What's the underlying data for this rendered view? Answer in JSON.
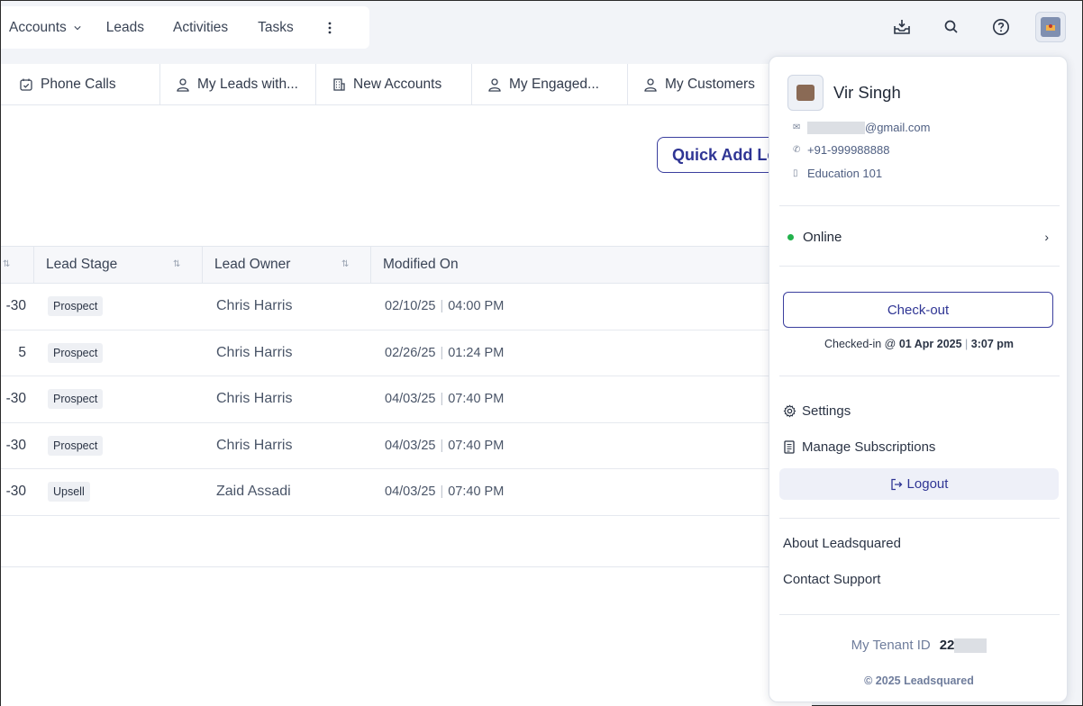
{
  "topnav": {
    "accounts": "Accounts",
    "leads": "Leads",
    "activities": "Activities",
    "tasks": "Tasks"
  },
  "tabs": [
    {
      "label": "Phone Calls",
      "icon": "calendar-check-icon"
    },
    {
      "label": "My Leads with...",
      "icon": "user-icon"
    },
    {
      "label": "New Accounts",
      "icon": "building-icon"
    },
    {
      "label": "My Engaged...",
      "icon": "user-icon"
    },
    {
      "label": "My Customers",
      "icon": "user-icon"
    }
  ],
  "main": {
    "quick_add_label": "Quick Add Le"
  },
  "table": {
    "headers": [
      "Lead Stage",
      "Lead Owner",
      "Modified On"
    ],
    "rows": [
      {
        "left": "-30",
        "stage": "Prospect",
        "owner": "Chris Harris",
        "date": "02/10/25",
        "time": "04:00 PM"
      },
      {
        "left": "5",
        "stage": "Prospect",
        "owner": "Chris Harris",
        "date": "02/26/25",
        "time": "01:24 PM"
      },
      {
        "left": "-30",
        "stage": "Prospect",
        "owner": "Chris Harris",
        "date": "04/03/25",
        "time": "07:40 PM"
      },
      {
        "left": "-30",
        "stage": "Prospect",
        "owner": "Chris Harris",
        "date": "04/03/25",
        "time": "07:40 PM"
      },
      {
        "left": "-30",
        "stage": "Upsell",
        "owner": "Zaid Assadi",
        "date": "04/03/25",
        "time": "07:40 PM"
      }
    ]
  },
  "profile": {
    "name": "Vir Singh",
    "email_suffix": "@gmail.com",
    "phone": "+91-999988888",
    "org": "Education 101",
    "status": "Online",
    "checkout_label": "Check-out",
    "checked_in_prefix": "Checked-in @ ",
    "checked_in_date": "01 Apr 2025",
    "checked_in_sep": " | ",
    "checked_in_time": "3:07 pm",
    "settings": "Settings",
    "manage_subscriptions": "Manage Subscriptions",
    "logout": "Logout",
    "about": "About Leadsquared",
    "contact": "Contact Support",
    "tenant_label": "My Tenant ID",
    "tenant_value": "22",
    "copyright": "© 2025 Leadsquared"
  },
  "colors": {
    "accent": "#2f3594",
    "online": "#22b24c"
  }
}
